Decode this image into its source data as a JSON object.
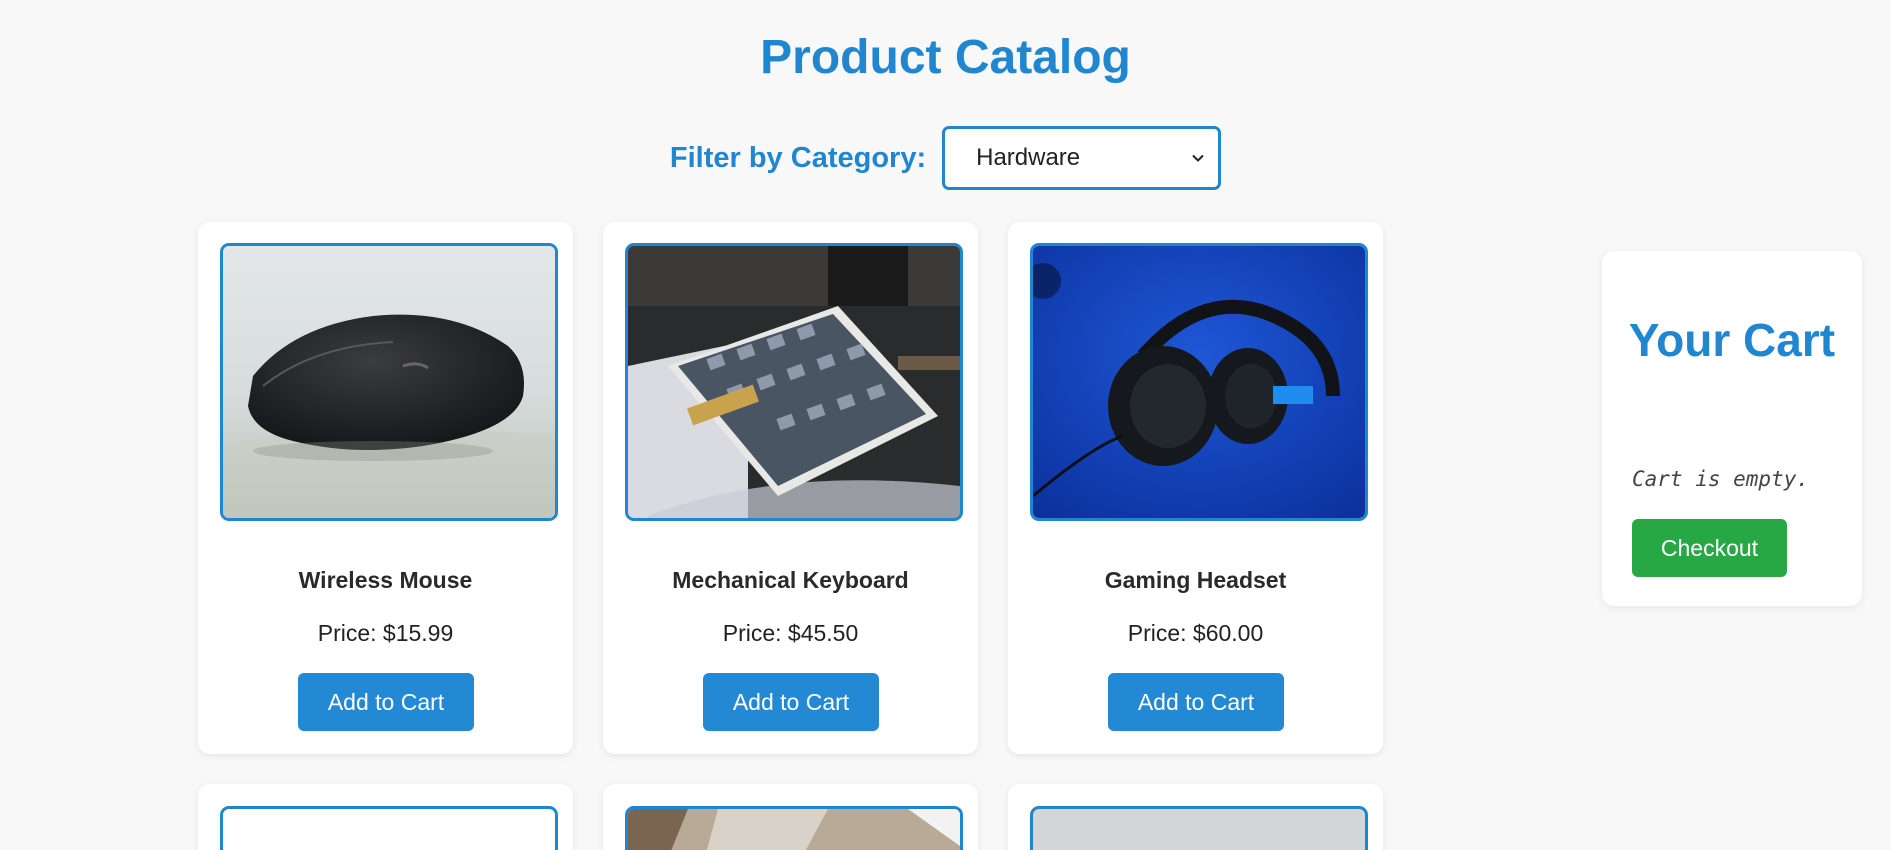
{
  "page": {
    "title": "Product Catalog"
  },
  "filter": {
    "label": "Filter by Category:",
    "selected": "Hardware"
  },
  "products": [
    {
      "name": "Wireless Mouse",
      "price": "Price: $15.99",
      "button": "Add to Cart",
      "image": "wireless-mouse-photo"
    },
    {
      "name": "Mechanical Keyboard",
      "price": "Price: $45.50",
      "button": "Add to Cart",
      "image": "mechanical-keyboard-photo"
    },
    {
      "name": "Gaming Headset",
      "price": "Price: $60.00",
      "button": "Add to Cart",
      "image": "gaming-headset-photo"
    }
  ],
  "cart": {
    "title": "Your Cart",
    "empty_text": "Cart is empty.",
    "checkout_label": "Checkout"
  },
  "colors": {
    "accent": "#1f86cf",
    "button": "#2489d4",
    "checkout": "#28a745",
    "background": "#f8f8f8"
  }
}
